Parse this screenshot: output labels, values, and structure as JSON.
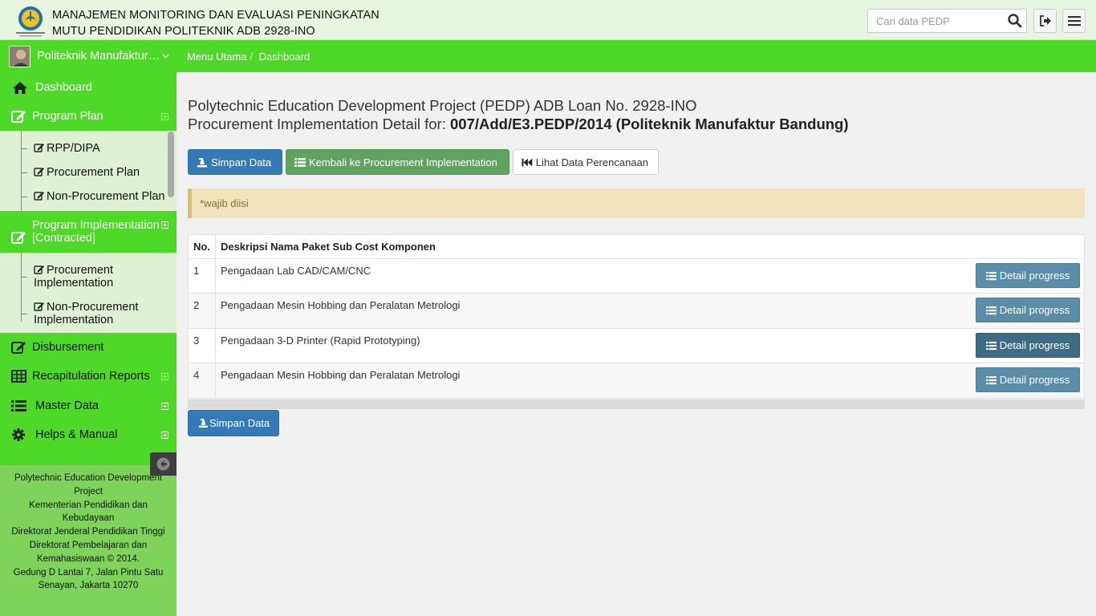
{
  "header": {
    "title_line1": "MANAJEMEN MONITORING DAN EVALUASI PENINGKATAN",
    "title_line2": "MUTU PENDIDIKAN POLITEKNIK ADB 2928-INO",
    "search_placeholder": "Cari data PEDP",
    "icons": [
      "search-icon",
      "logout-icon",
      "menu-icon"
    ]
  },
  "user": {
    "name": "Politeknik Manufaktur…"
  },
  "breadcrumb": {
    "items": [
      "Menu Utama",
      "Dashboard"
    ]
  },
  "sidebar": {
    "dashboard": "Dashboard",
    "program_plan": "Program Plan",
    "program_plan_items": [
      "RPP/DIPA",
      "Procurement Plan",
      "Non-Procurement Plan"
    ],
    "program_implementation": "Program Implementation [Contracted]",
    "program_implementation_items": [
      "Procurement Implementation",
      "Non-Procurement Implementation"
    ],
    "disbursement": "Disbursement",
    "recap": "Recapitulation Reports",
    "master": "Master Data",
    "helps": "Helps & Manual"
  },
  "footer": {
    "lines": [
      "Polytechnic Education Development Project",
      "Kementerian Pendidikan dan Kebudayaan",
      "Direktorat Jenderal Pendidikan Tinggi",
      "Direktorat Pembelajaran dan Kemahasiswaan © 2014.",
      "Gedung D Lantai 7, Jalan Pintu Satu Senayan, Jakarta 10270"
    ]
  },
  "main": {
    "title_line1": "Polytechnic Education Development Project (PEDP) ADB Loan No. 2928-INO",
    "title_line2_prefix": "Procurement Implementation Detail for: ",
    "title_line2_bold": "007/Add/E3.PEDP/2014 (Politeknik Manufaktur Bandung)",
    "buttons": {
      "simpan": "Simpan Data",
      "kembali": "Kembali ke Procurement Implementation",
      "lihat": "Lihat Data Perencanaan"
    },
    "alert": "*wajib diisi",
    "table": {
      "headers": [
        "No.",
        "Deskripsi Nama Paket Sub Cost Komponen"
      ],
      "rows": [
        {
          "no": "1",
          "desc": "Pengadaan Lab CAD/CAM/CNC",
          "action": "Detail progress"
        },
        {
          "no": "2",
          "desc": "Pengadaan Mesin Hobbing dan Peralatan Metrologi",
          "action": "Detail progress"
        },
        {
          "no": "3",
          "desc": "Pengadaan 3-D Printer (Rapid Prototyping)",
          "action": "Detail progress"
        },
        {
          "no": "4",
          "desc": "Pengadaan Mesin Hobbing dan Peralatan Metrologi",
          "action": "Detail progress"
        }
      ]
    },
    "bottom_button": "Simpan Data"
  }
}
